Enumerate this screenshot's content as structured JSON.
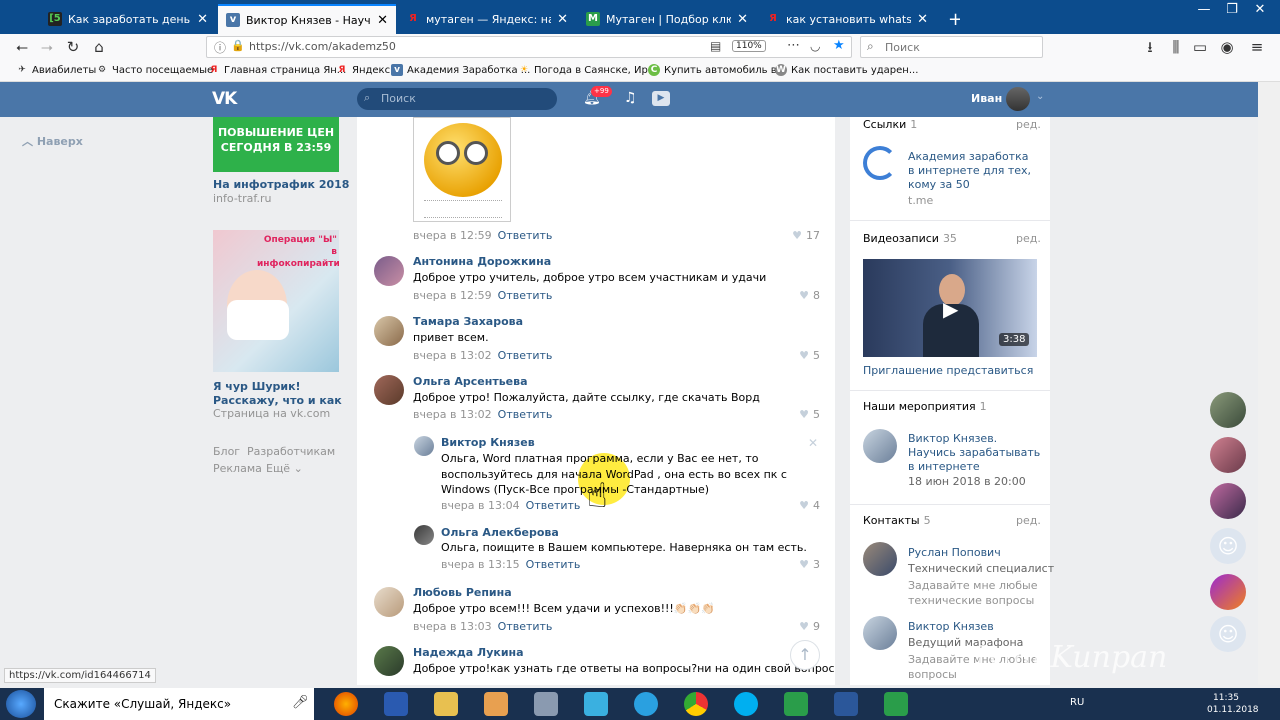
{
  "browser": {
    "tabs": [
      {
        "title": "Как заработать деньги в Интернете",
        "favicon": "ЕБ",
        "color": "#222"
      },
      {
        "title": "Виктор Князев - Научитесь зарабатывать",
        "favicon": "VK",
        "color": "#4a76a8"
      },
      {
        "title": "мутаген — Яндекс: нашлось",
        "favicon": "Я",
        "color": "#e22"
      },
      {
        "title": "Мутаген | Подбор ключей",
        "favicon": "M",
        "color": "#2a9d4a"
      },
      {
        "title": "как установить whatsapp на телефон",
        "favicon": "Я",
        "color": "#e22"
      }
    ],
    "url": "https://vk.com/akademz50",
    "zoom": "110%",
    "search_placeholder": "Поиск",
    "bookmarks": [
      {
        "label": "Авиабилеты",
        "icon": "plane-icon"
      },
      {
        "label": "Часто посещаемые",
        "icon": "gear-icon"
      },
      {
        "label": "Главная страница Ян...",
        "icon": "yandex-icon"
      },
      {
        "label": "Яндекс",
        "icon": "yandex-icon"
      },
      {
        "label": "Академия Заработка ...",
        "icon": "vk-icon"
      },
      {
        "label": "Погода в Саянске, Ир...",
        "icon": "weather-icon"
      },
      {
        "label": "Купить автомобиль в...",
        "icon": "car-icon"
      },
      {
        "label": "Как поставить ударен...",
        "icon": "wiki-icon"
      }
    ],
    "status_url": "https://vk.com/id164466714"
  },
  "vk": {
    "search_placeholder": "Поиск",
    "notif_badge": "+99",
    "user_name": "Иван"
  },
  "left": {
    "back_to_top": "Наверх",
    "ad1_banner": "ПОВЫШЕНИЕ ЦЕН СЕГОДНЯ В 23:59",
    "ad1_title": "На инфотрафик 2018",
    "ad1_sub": "info-traf.ru",
    "ad2_banner": "Операция \"Ы\" в инфокопирайтинге",
    "ad2_title": "Я чур Шурик! Расскажу, что и как",
    "ad2_sub": "Страница на vk.com",
    "footer": {
      "blog": "Блог",
      "dev": "Разработчикам",
      "ads": "Реклама",
      "more": "Ещё ⌄"
    }
  },
  "comments": {
    "c0": {
      "meta": "вчера в 12:59",
      "reply": "Ответить",
      "likes": "17"
    },
    "c1": {
      "author": "Антонина Дорожкина",
      "text": "Доброе утро учитель, доброе утро всем участникам и удачи",
      "meta": "вчера в 12:59",
      "reply": "Ответить",
      "likes": "8"
    },
    "c2": {
      "author": "Тамара Захарова",
      "text": "привет всем.",
      "meta": "вчера в 13:02",
      "reply": "Ответить",
      "likes": "5"
    },
    "c3": {
      "author": "Ольга Арсентьева",
      "text": "Доброе утро! Пожалуйста, дайте ссылку, где скачать Ворд",
      "meta": "вчера в 13:02",
      "reply": "Ответить",
      "likes": "5"
    },
    "c4": {
      "author": "Виктор Князев",
      "text": "Ольга, Word платная программа, если у Вас ее нет, то воспользуйтесь для начала WordPad , она есть во всех пк с Windows (Пуск-Все программы -Стандартные)",
      "meta": "вчера в 13:04",
      "reply": "Ответить",
      "likes": "4"
    },
    "c5": {
      "author": "Ольга Алекберова",
      "text": "Ольга, поищите в Вашем компьютере. Наверняка он там есть.",
      "meta": "вчера в 13:15",
      "reply": "Ответить",
      "likes": "3"
    },
    "c6": {
      "author": "Любовь Репина",
      "text": "Доброе утро всем!!! Всем удачи и успехов!!!👏🏻👏🏻👏🏻",
      "meta": "вчера в 13:03",
      "reply": "Ответить",
      "likes": "9"
    },
    "c7": {
      "author": "Надежда Лукина",
      "text": "Доброе утро!как узнать где ответы на вопросы?ни на один свой вопрос"
    }
  },
  "right": {
    "links": {
      "title": "Ссылки",
      "count": "1",
      "edit": "ред.",
      "name": "Академия заработка в интернете для тех, кому за 50",
      "domain": "t.me"
    },
    "videos": {
      "title": "Видеозаписи",
      "count": "35",
      "edit": "ред.",
      "duration": "3:38",
      "name": "Приглашение представиться"
    },
    "events": {
      "title": "Наши мероприятия",
      "count": "1",
      "name": "Виктор Князев. Научись зарабатывать в интернете",
      "date": "18 июн 2018 в 20:00"
    },
    "contacts": {
      "title": "Контакты",
      "count": "5",
      "edit": "ред.",
      "p1_name": "Руслан Попович",
      "p1_role": "Технический специалист",
      "p1_desc": "Задавайте мне любые технические вопросы",
      "p2_name": "Виктор Князев",
      "p2_role": "Ведущий марафона",
      "p2_desc": "Задавайте мне любые вопросы"
    }
  },
  "watermark": "Ivan Kunpan",
  "taskbar": {
    "search": "Скажите «Слушай, Яндекс»",
    "lang": "RU",
    "time": "11:35",
    "date": "01.11.2018"
  }
}
